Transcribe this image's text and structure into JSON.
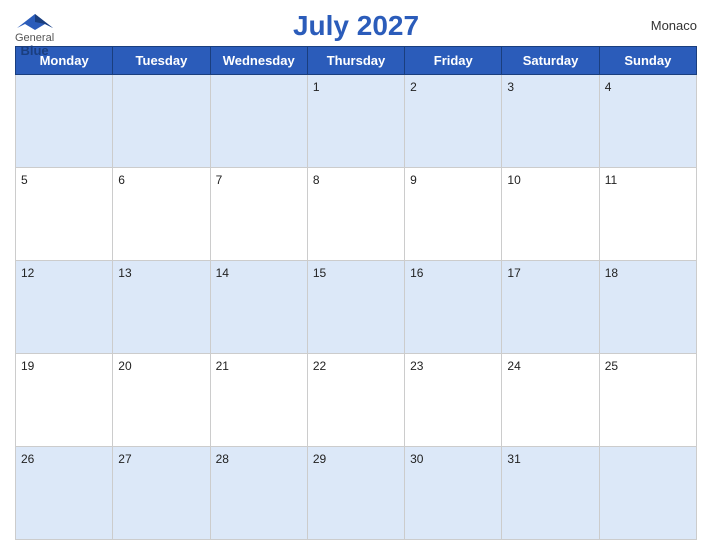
{
  "logo": {
    "general": "General",
    "blue": "Blue"
  },
  "title": "July 2027",
  "country": "Monaco",
  "days_of_week": [
    "Monday",
    "Tuesday",
    "Wednesday",
    "Thursday",
    "Friday",
    "Saturday",
    "Sunday"
  ],
  "weeks": [
    [
      {
        "day": "",
        "empty": true
      },
      {
        "day": "",
        "empty": true
      },
      {
        "day": "",
        "empty": true
      },
      {
        "day": "1",
        "empty": false
      },
      {
        "day": "2",
        "empty": false
      },
      {
        "day": "3",
        "empty": false
      },
      {
        "day": "4",
        "empty": false
      }
    ],
    [
      {
        "day": "5",
        "empty": false
      },
      {
        "day": "6",
        "empty": false
      },
      {
        "day": "7",
        "empty": false
      },
      {
        "day": "8",
        "empty": false
      },
      {
        "day": "9",
        "empty": false
      },
      {
        "day": "10",
        "empty": false
      },
      {
        "day": "11",
        "empty": false
      }
    ],
    [
      {
        "day": "12",
        "empty": false
      },
      {
        "day": "13",
        "empty": false
      },
      {
        "day": "14",
        "empty": false
      },
      {
        "day": "15",
        "empty": false
      },
      {
        "day": "16",
        "empty": false
      },
      {
        "day": "17",
        "empty": false
      },
      {
        "day": "18",
        "empty": false
      }
    ],
    [
      {
        "day": "19",
        "empty": false
      },
      {
        "day": "20",
        "empty": false
      },
      {
        "day": "21",
        "empty": false
      },
      {
        "day": "22",
        "empty": false
      },
      {
        "day": "23",
        "empty": false
      },
      {
        "day": "24",
        "empty": false
      },
      {
        "day": "25",
        "empty": false
      }
    ],
    [
      {
        "day": "26",
        "empty": false
      },
      {
        "day": "27",
        "empty": false
      },
      {
        "day": "28",
        "empty": false
      },
      {
        "day": "29",
        "empty": false
      },
      {
        "day": "30",
        "empty": false
      },
      {
        "day": "31",
        "empty": false
      },
      {
        "day": "",
        "empty": true
      }
    ]
  ]
}
